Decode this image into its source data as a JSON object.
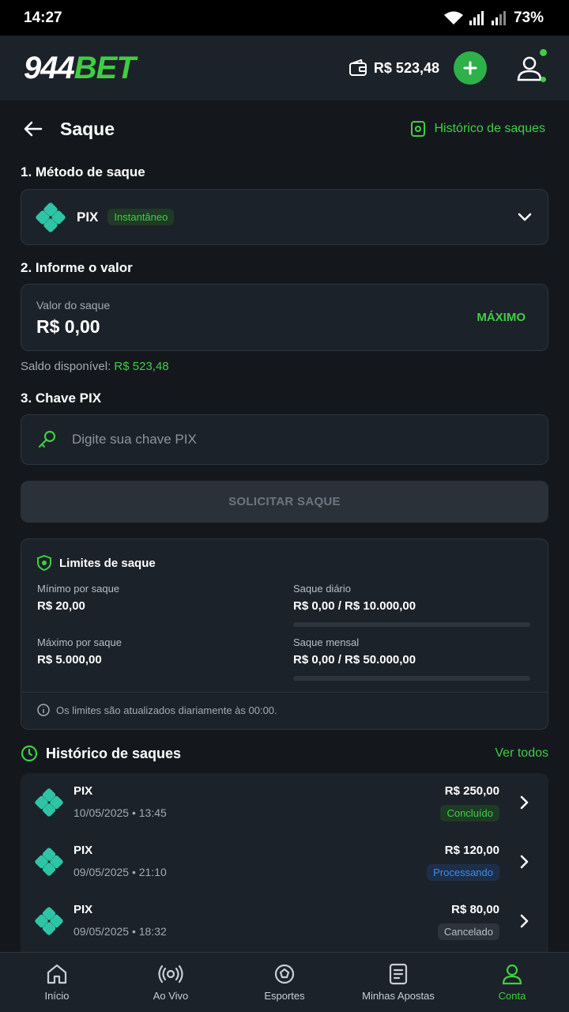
{
  "status_bar": {
    "time": "14:27",
    "battery": "73%"
  },
  "header": {
    "logo_num": "944",
    "logo_bet": "BET",
    "balance": "R$ 523,48"
  },
  "page": {
    "title": "Saque",
    "history_link": "Histórico de saques"
  },
  "method": {
    "section_label": "1. Método de saque",
    "name": "PIX",
    "badge": "Instantâneo"
  },
  "amount": {
    "section_label": "2. Informe o valor",
    "field_label": "Valor do saque",
    "value": "R$ 0,00",
    "max_label": "MÁXIMO",
    "balance_label": "Saldo disponível:",
    "balance_value": "R$ 523,48"
  },
  "pix_key": {
    "section_label": "3. Chave PIX",
    "placeholder": "Digite sua chave PIX"
  },
  "submit_label": "SOLICITAR SAQUE",
  "limits": {
    "title": "Limites de saque",
    "min_label": "Mínimo por saque",
    "min_value": "R$ 20,00",
    "max_label": "Máximo por saque",
    "max_value": "R$ 5.000,00",
    "daily_label": "Saque diário",
    "daily_value": "R$ 0,00 / R$ 10.000,00",
    "daily_progress": 0,
    "monthly_label": "Saque mensal",
    "monthly_value": "R$ 0,00 / R$ 50.000,00",
    "monthly_progress": 0,
    "note": "Os limites são atualizados diariamente às 00:00."
  },
  "history": {
    "title": "Histórico de saques",
    "see_all": "Ver todos",
    "items": [
      {
        "method": "PIX",
        "date": "10/05/2025 • 13:45",
        "amount": "R$ 250,00",
        "status": "Concluído"
      },
      {
        "method": "PIX",
        "date": "09/05/2025 • 21:10",
        "amount": "R$ 120,00",
        "status": "Processando"
      },
      {
        "method": "PIX",
        "date": "09/05/2025 • 18:32",
        "amount": "R$ 80,00",
        "status": "Cancelado"
      }
    ]
  },
  "bottom_nav": [
    {
      "label": "Início",
      "icon": "home-icon"
    },
    {
      "label": "Ao Vivo",
      "icon": "live-icon"
    },
    {
      "label": "Esportes",
      "icon": "soccer-ball-icon"
    },
    {
      "label": "Minhas Apostas",
      "icon": "bets-icon"
    },
    {
      "label": "Conta",
      "icon": "user-icon",
      "active": true
    }
  ],
  "colors": {
    "accent": "#3fce42",
    "background": "#14181d",
    "card": "#1c2229"
  }
}
